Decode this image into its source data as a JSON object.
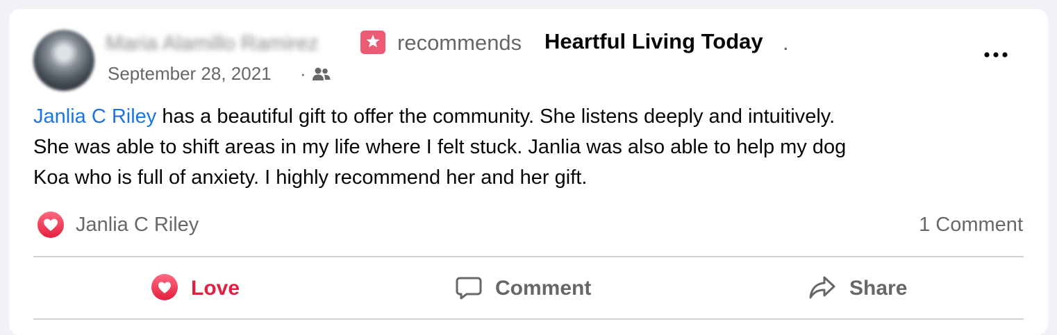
{
  "post": {
    "author_name": "Maria Alamillo Ramirez",
    "recommends_text": "recommends",
    "page_name": "Heartful Living Today",
    "page_name_suffix": ".",
    "date": "September 28, 2021",
    "date_separator": "·",
    "audience_icon": "friends-icon",
    "body": {
      "mention": "Janlia C Riley",
      "text_line1": " has a beautiful gift to offer the community.  She listens deeply and intuitively.",
      "text_line2": "She was able to shift areas in my life where I felt stuck.  Janlia was also able to help my dog",
      "text_line3": "Koa who is full of anxiety.  I highly recommend her and her gift."
    }
  },
  "reactions": {
    "icon": "love-reaction-icon",
    "names": "Janlia C Riley",
    "comment_count": "1 Comment"
  },
  "actions": {
    "love": "Love",
    "comment": "Comment",
    "share": "Share"
  },
  "colors": {
    "love": "#e41e3f",
    "mention": "#1b74e4",
    "secondary_text": "#65676b",
    "recommend_badge": "#ed5a73"
  }
}
